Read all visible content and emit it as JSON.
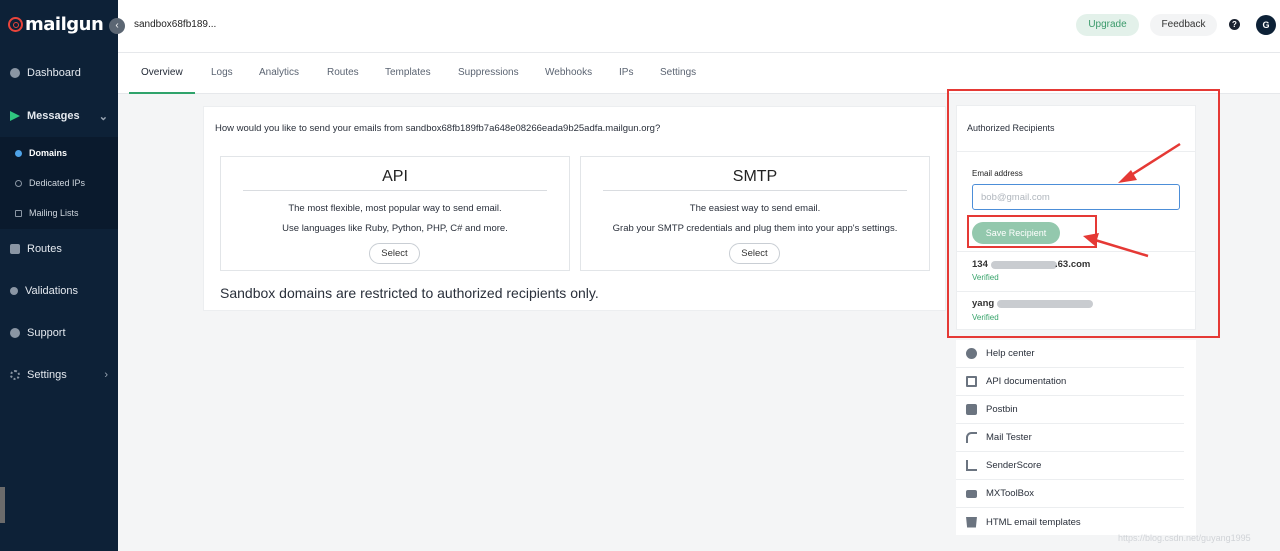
{
  "app": {
    "logo_text": "mailgun",
    "domain_title": "sandbox68fb189...",
    "collapse_icon": "‹"
  },
  "header": {
    "upgrade_label": "Upgrade",
    "feedback_label": "Feedback",
    "help_label": "?",
    "avatar_initial": "G"
  },
  "sidebar": {
    "items": [
      {
        "label": "Dashboard",
        "icon": "dashboard-icon"
      },
      {
        "label": "Messages",
        "icon": "paper-plane-icon",
        "chevron": "⌄"
      },
      {
        "label": "Routes",
        "icon": "routes-icon"
      },
      {
        "label": "Validations",
        "icon": "validations-icon"
      },
      {
        "label": "Support",
        "icon": "support-icon"
      },
      {
        "label": "Settings",
        "icon": "gear-icon",
        "chevron": "›"
      }
    ],
    "sub_items": [
      {
        "label": "Domains",
        "active": true
      },
      {
        "label": "Dedicated IPs",
        "active": false
      },
      {
        "label": "Mailing Lists",
        "active": false
      }
    ]
  },
  "tabs": [
    "Overview",
    "Logs",
    "Analytics",
    "Routes",
    "Templates",
    "Suppressions",
    "Webhooks",
    "IPs",
    "Settings"
  ],
  "main": {
    "question": "How would you like to send your emails from sandbox68fb189fb7a648e08266eada9b25adfa.mailgun.org?",
    "api": {
      "title": "API",
      "line1": "The most flexible, most popular way to send email.",
      "line2": "Use languages like Ruby, Python, PHP, C# and more.",
      "button": "Select"
    },
    "smtp": {
      "title": "SMTP",
      "line1": "The easiest way to send email.",
      "line2": "Grab your SMTP credentials and plug them into your app's settings.",
      "button": "Select"
    },
    "restricted_notice": "Sandbox domains are restricted to authorized recipients only."
  },
  "recipients": {
    "title": "Authorized Recipients",
    "email_label": "Email address",
    "email_placeholder": "bob@gmail.com",
    "save_label": "Save Recipient",
    "list": [
      {
        "email_start": "134",
        "email_end": ".63.com",
        "status": "Verified"
      },
      {
        "email_start": "yang",
        "email_end": "",
        "status": "Verified"
      }
    ]
  },
  "resources": [
    {
      "label": "Help center",
      "icon": "help-circle-icon"
    },
    {
      "label": "API documentation",
      "icon": "api-grid-icon"
    },
    {
      "label": "Postbin",
      "icon": "inbox-icon"
    },
    {
      "label": "Mail Tester",
      "icon": "mail-tester-icon"
    },
    {
      "label": "SenderScore",
      "icon": "bar-chart-icon"
    },
    {
      "label": "MXToolBox",
      "icon": "mxtoolbox-icon"
    },
    {
      "label": "HTML email templates",
      "icon": "html5-icon"
    }
  ],
  "watermark": "https://blog.csdn.net/guyang1995",
  "colors": {
    "sidebar_bg": "#0d2137",
    "accent_green": "#2fa36b",
    "annotation_red": "#e53935"
  }
}
